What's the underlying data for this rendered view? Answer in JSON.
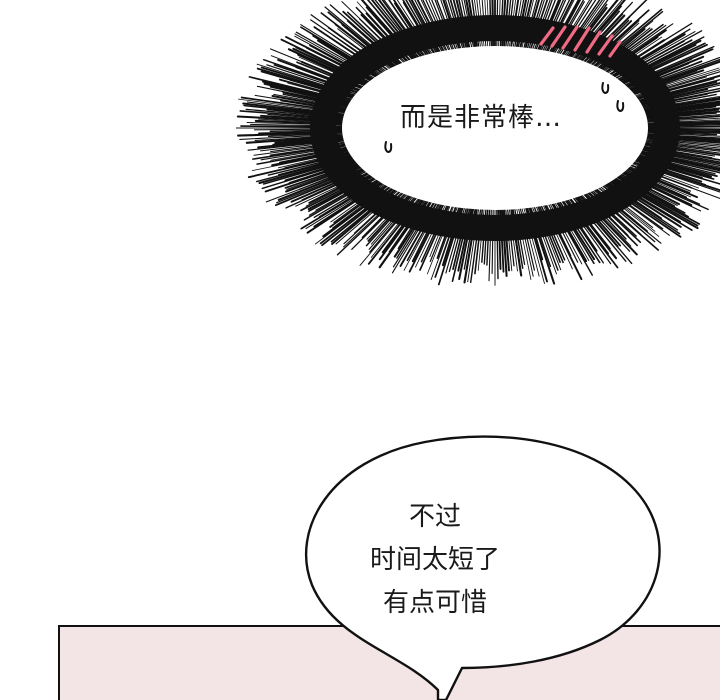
{
  "thought_bubble": {
    "text": "而是非常棒…"
  },
  "speech_bubble": {
    "lines": [
      "不过",
      "时间太短了",
      "有点可惜"
    ]
  },
  "colors": {
    "background": "#ffffff",
    "ink": "#111111",
    "blush": "#f06a84",
    "panel": "#f3e4e6"
  }
}
